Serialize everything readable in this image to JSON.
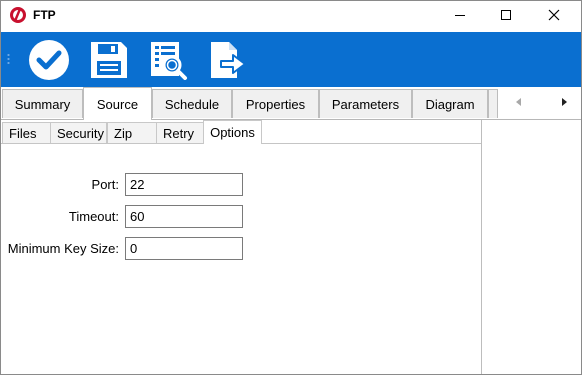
{
  "window": {
    "title": "FTP"
  },
  "toolbar": {
    "buttons": [
      {
        "icon": "checkmark-icon",
        "label": ""
      },
      {
        "icon": "save-icon",
        "label": ""
      },
      {
        "icon": "report-search-icon",
        "label": ""
      },
      {
        "icon": "export-icon",
        "label": ""
      }
    ],
    "color": "#0a6fd0"
  },
  "main_tabs": {
    "items": [
      "Summary",
      "Source",
      "Schedule",
      "Properties",
      "Parameters",
      "Diagram"
    ],
    "active": "Source"
  },
  "sub_tabs": {
    "items": [
      "Files",
      "Security",
      "Zip",
      "Retry",
      "Options"
    ],
    "active": "Options"
  },
  "options": {
    "port_label": "Port:",
    "port_value": "22",
    "timeout_label": "Timeout:",
    "timeout_value": "60",
    "key_size_label": "Minimum Key Size:",
    "key_size_value": "0"
  }
}
